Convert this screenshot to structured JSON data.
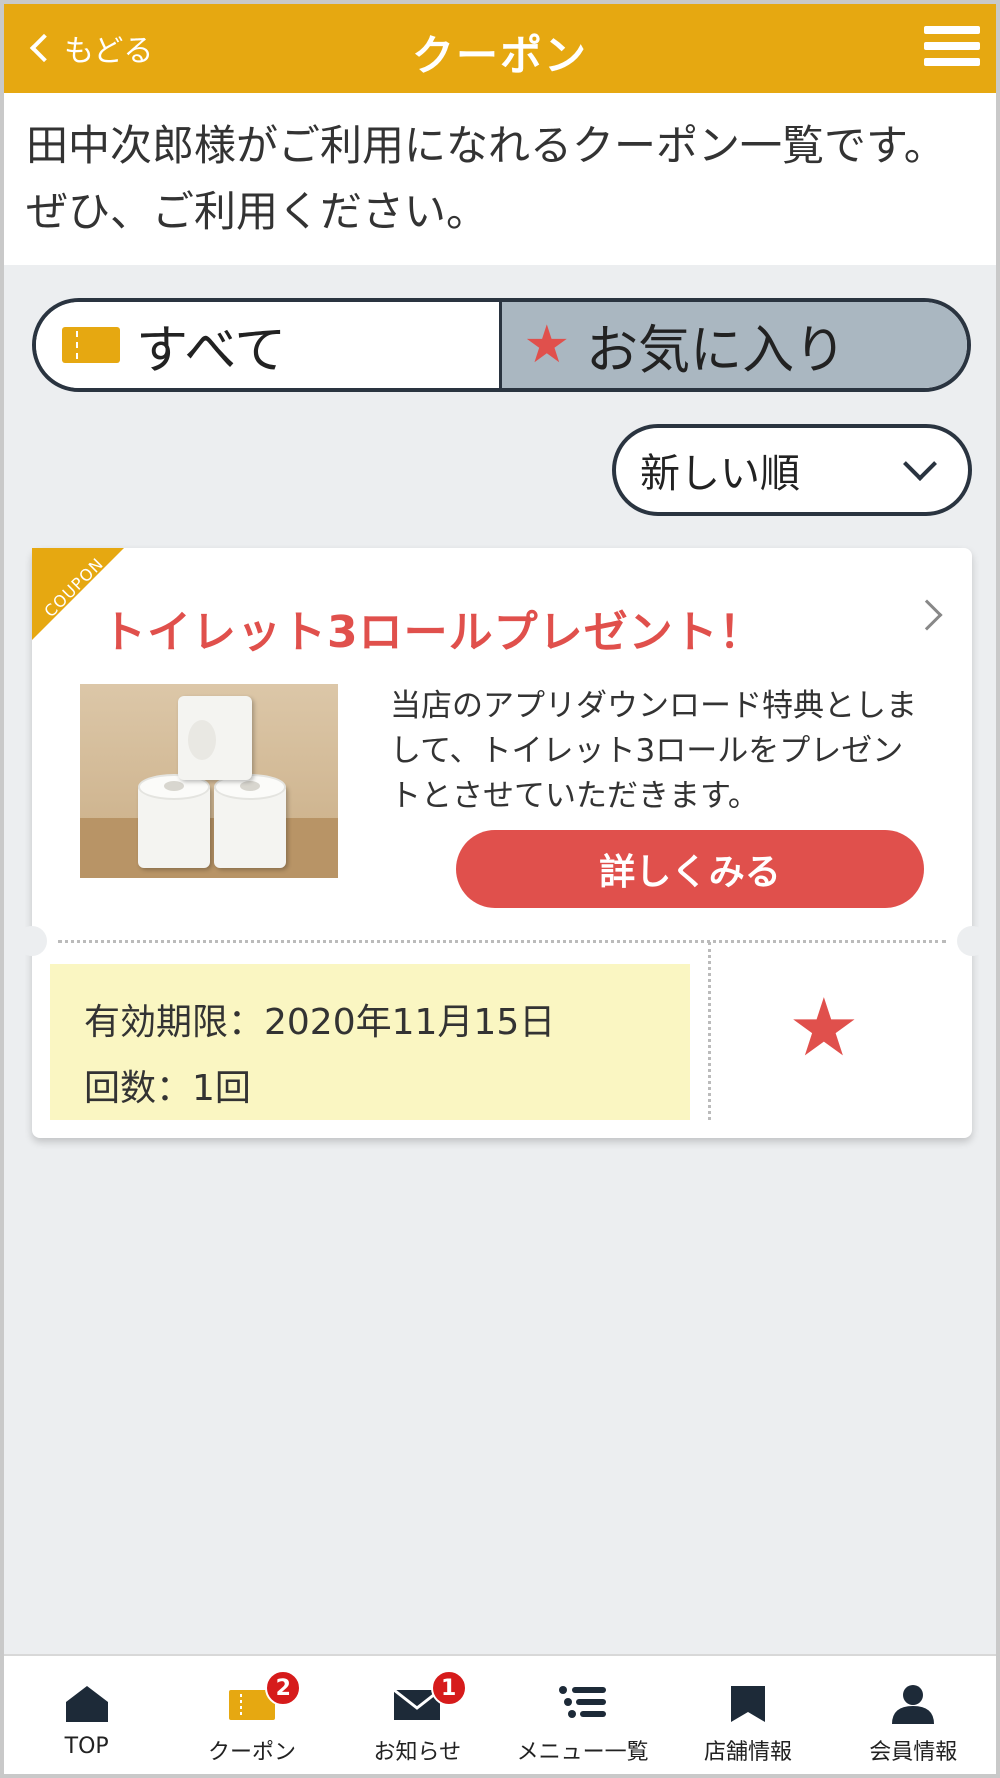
{
  "header": {
    "back_label": "もどる",
    "title": "クーポン"
  },
  "intro": {
    "text": "田中次郎様がご利用になれるクーポン一覧です。ぜひ、ご利用ください。"
  },
  "tabs": [
    {
      "label": "すべて",
      "icon": "ticket-icon",
      "selected": true
    },
    {
      "label": "お気に入り",
      "icon": "star-icon",
      "selected": false
    }
  ],
  "sort": {
    "selected": "新しい順"
  },
  "coupon": {
    "corner_label": "COUPON",
    "title": "トイレット3ロールプレゼント！",
    "description": "当店のアプリダウンロード特典としまして、トイレット3ロールをプレゼントとさせていただきます。",
    "detail_button": "詳しくみる",
    "expiry": "有効期限：2020年11月15日",
    "count": "回数：1回",
    "favorite": true
  },
  "bottom_nav": [
    {
      "label": "TOP",
      "icon": "home-icon"
    },
    {
      "label": "クーポン",
      "icon": "ticket-icon",
      "badge": "2"
    },
    {
      "label": "お知らせ",
      "icon": "mail-icon",
      "badge": "1"
    },
    {
      "label": "メニュー一覧",
      "icon": "list-icon"
    },
    {
      "label": "店舗情報",
      "icon": "store-icon"
    },
    {
      "label": "会員情報",
      "icon": "person-icon"
    }
  ],
  "colors": {
    "accent": "#e6a811",
    "coupon_red": "#e0504c",
    "badge_red": "#d61b1b",
    "expiry_bg": "#faf6c2",
    "fav_tab_bg": "#aab7c1"
  }
}
